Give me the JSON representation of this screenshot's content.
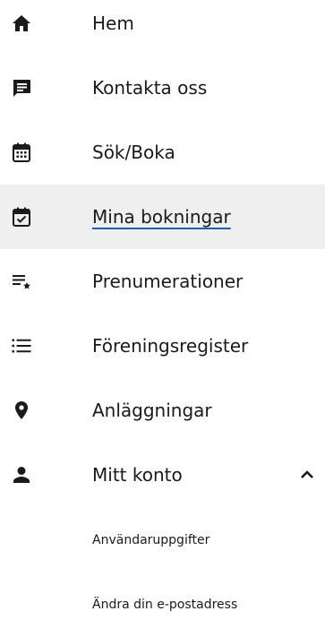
{
  "nav": {
    "items": [
      {
        "label": "Hem",
        "icon": "home-icon"
      },
      {
        "label": "Kontakta oss",
        "icon": "chat-icon"
      },
      {
        "label": "Sök/Boka",
        "icon": "calendar-grid-icon"
      },
      {
        "label": "Mina bokningar",
        "icon": "calendar-check-icon",
        "active": true
      },
      {
        "label": "Prenumerationer",
        "icon": "list-star-icon"
      },
      {
        "label": "Föreningsregister",
        "icon": "list-bullet-icon"
      },
      {
        "label": "Anläggningar",
        "icon": "location-pin-icon"
      },
      {
        "label": "Mitt konto",
        "icon": "person-icon",
        "expanded": true
      }
    ],
    "subitems": [
      {
        "label": "Användaruppgifter"
      },
      {
        "label": "Ändra din e-postadress"
      }
    ]
  },
  "colors": {
    "active_background": "#efefef",
    "active_underline": "#1d5fa8",
    "text": "#1a1a1a"
  }
}
